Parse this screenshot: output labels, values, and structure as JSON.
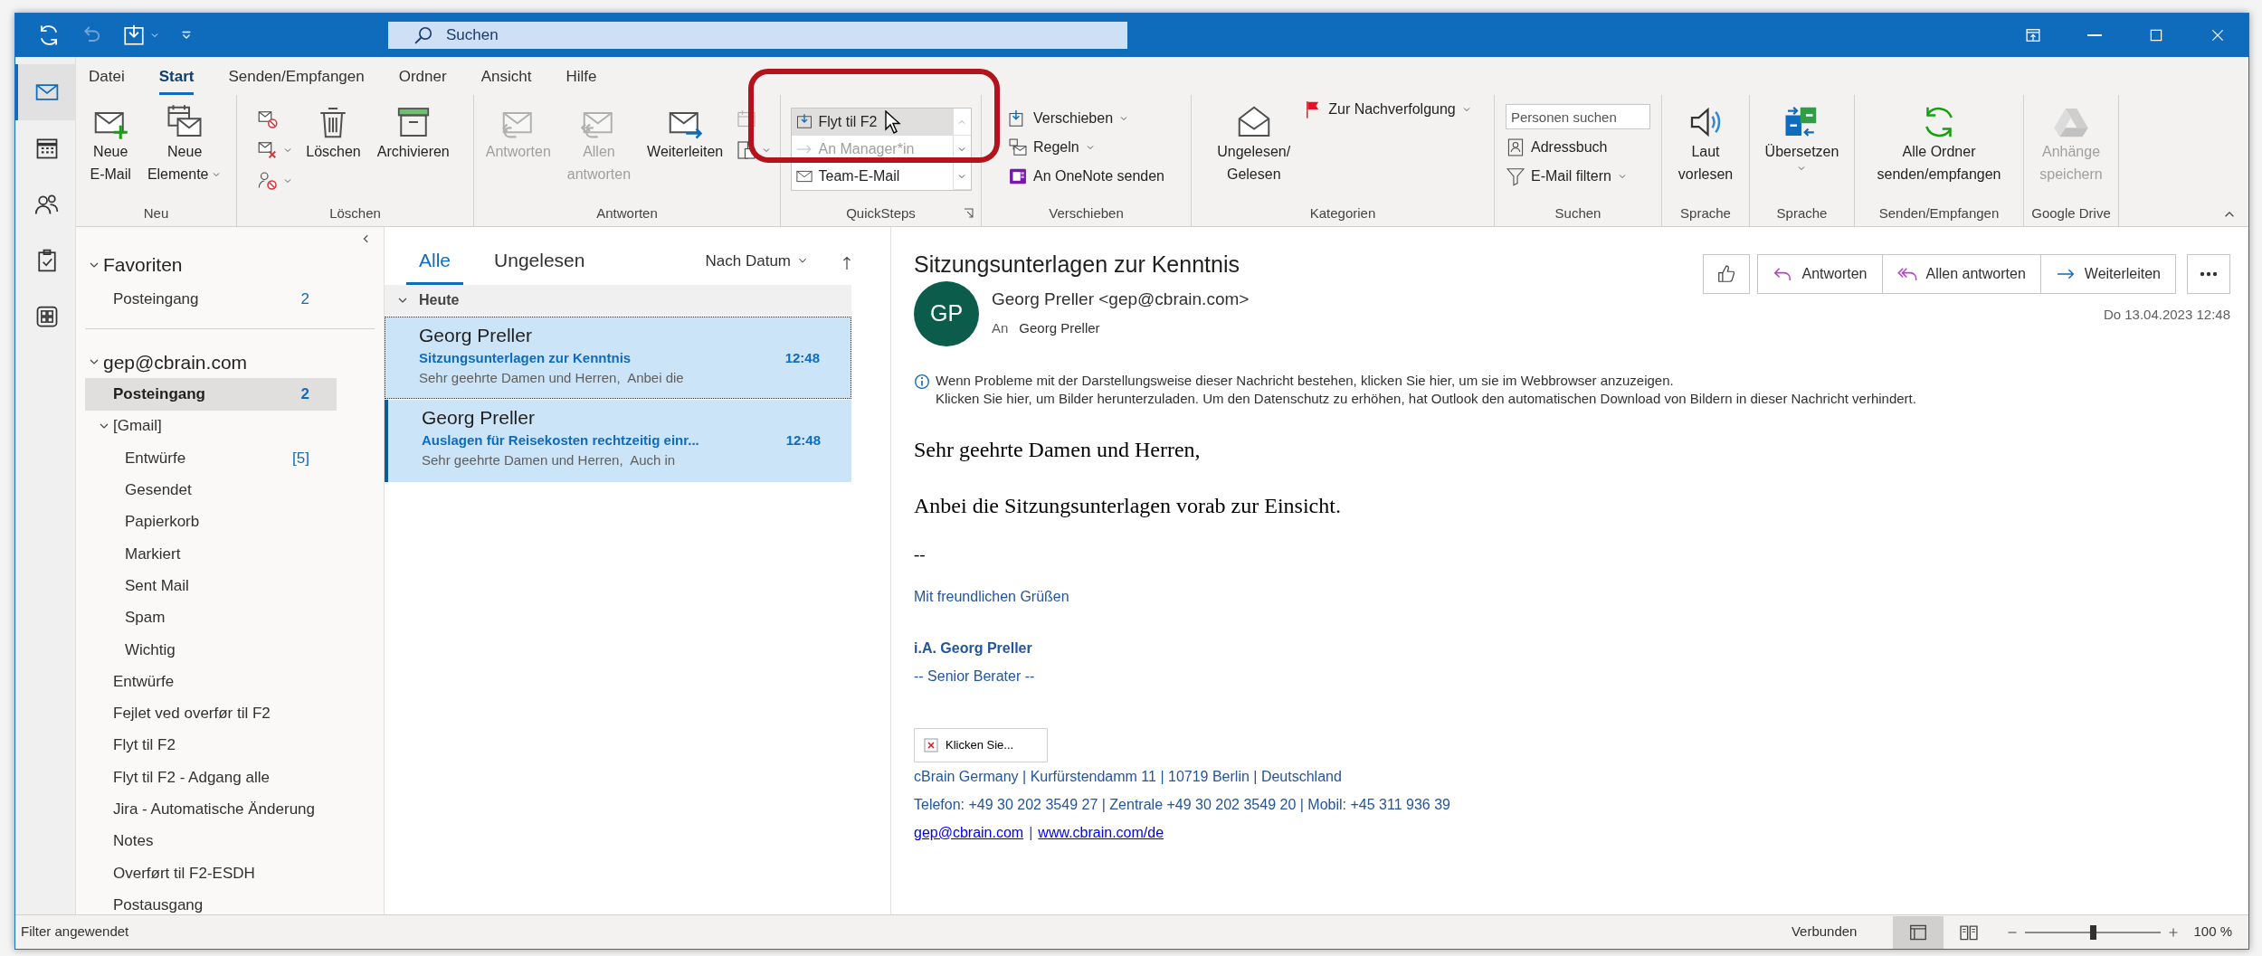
{
  "title_bar": {
    "search_placeholder": "Suchen"
  },
  "ribbon": {
    "tabs": [
      {
        "label": "Datei",
        "selected": false
      },
      {
        "label": "Start",
        "selected": true
      },
      {
        "label": "Senden/Empfangen",
        "selected": false
      },
      {
        "label": "Ordner",
        "selected": false
      },
      {
        "label": "Ansicht",
        "selected": false
      },
      {
        "label": "Hilfe",
        "selected": false
      }
    ],
    "groups": [
      {
        "label": "Neu",
        "items": [
          {
            "kind": "large",
            "label": "Neue\nE-Mail",
            "dropdown": false,
            "disabled": false
          },
          {
            "kind": "large",
            "label": "Neue\nElemente",
            "dropdown": true,
            "disabled": false
          }
        ]
      },
      {
        "label": "Löschen",
        "items": [
          {
            "kind": "stack",
            "items": [
              {
                "kind": "icon",
                "dropdown": false,
                "disabled": false
              },
              {
                "kind": "icon",
                "dropdown": true,
                "disabled": false
              },
              {
                "kind": "icon",
                "dropdown": true,
                "disabled": false
              }
            ]
          },
          {
            "kind": "large",
            "label": "Löschen",
            "dropdown": false,
            "disabled": false
          },
          {
            "kind": "large",
            "label": "Archivieren",
            "dropdown": false,
            "disabled": false
          }
        ]
      },
      {
        "label": "Antworten",
        "items": [
          {
            "kind": "large",
            "label": "Antworten",
            "dropdown": false,
            "disabled": true
          },
          {
            "kind": "large",
            "label": "Allen\nantworten",
            "dropdown": false,
            "disabled": true
          },
          {
            "kind": "large",
            "label": "Weiterleiten",
            "dropdown": false,
            "disabled": false
          },
          {
            "kind": "stack",
            "items": [
              {
                "kind": "icon",
                "dropdown": false,
                "disabled": true
              },
              {
                "kind": "icon",
                "dropdown": true,
                "disabled": false
              }
            ]
          }
        ]
      },
      {
        "label": "QuickSteps",
        "items": [
          {
            "kind": "quicksteps",
            "items": [
              {
                "label": "Flyt til F2",
                "highlighted": true,
                "disabled": false
              },
              {
                "label": "An Manager*in",
                "highlighted": false,
                "disabled": true
              },
              {
                "label": "Team-E-Mail",
                "highlighted": false,
                "disabled": false
              }
            ]
          }
        ]
      },
      {
        "label": "Verschieben",
        "items": [
          {
            "kind": "stack",
            "items": [
              {
                "kind": "small",
                "label": "Verschieben",
                "dropdown": true,
                "disabled": false
              },
              {
                "kind": "small",
                "label": "Regeln",
                "dropdown": true,
                "disabled": false
              },
              {
                "kind": "small",
                "label": "An OneNote senden",
                "dropdown": false,
                "disabled": false
              }
            ]
          }
        ]
      },
      {
        "label": "Kategorien",
        "items": [
          {
            "kind": "large",
            "label": "Ungelesen/\nGelesen",
            "dropdown": false,
            "disabled": false
          },
          {
            "kind": "small",
            "label": "Zur Nachverfolgung",
            "dropdown": true,
            "disabled": false
          }
        ]
      },
      {
        "label": "Suchen",
        "items": [
          {
            "kind": "stack",
            "items": [
              {
                "kind": "search",
                "placeholder": "Personen suchen"
              },
              {
                "kind": "small",
                "label": "Adressbuch",
                "dropdown": false,
                "disabled": false
              },
              {
                "kind": "small",
                "label": "E-Mail filtern",
                "dropdown": true,
                "disabled": false
              }
            ]
          }
        ]
      },
      {
        "label": "Sprache",
        "items": [
          {
            "kind": "large",
            "label": "Laut\nvorlesen",
            "dropdown": false,
            "disabled": false
          }
        ]
      },
      {
        "label": "Sprache",
        "items": [
          {
            "kind": "large",
            "label": "Übersetzen",
            "dropdown": true,
            "disabled": false
          }
        ]
      },
      {
        "label": "Senden/Empfangen",
        "items": [
          {
            "kind": "large",
            "label": "Alle Ordner\nsenden/empfangen",
            "dropdown": false,
            "disabled": false
          }
        ]
      },
      {
        "label": "Google Drive",
        "items": [
          {
            "kind": "large",
            "label": "Anhänge\nspeichern",
            "dropdown": false,
            "disabled": true
          }
        ]
      }
    ]
  },
  "nav_rail": [
    {
      "selected": true
    },
    {
      "selected": false
    },
    {
      "selected": false
    },
    {
      "selected": false
    },
    {
      "selected": false
    }
  ],
  "folders": [
    {
      "label": "Favoriten",
      "expanded": true,
      "children": [
        {
          "label": "Posteingang",
          "count": "2",
          "selected": false
        }
      ]
    },
    {
      "label": "gep@cbrain.com",
      "expanded": true,
      "children": [
        {
          "label": "Posteingang",
          "count": "2",
          "selected": true
        },
        {
          "label": "[Gmail]",
          "expanded": true,
          "selected": false,
          "children": [
            {
              "label": "Entwürfe",
              "count": "[5]",
              "selected": false
            },
            {
              "label": "Gesendet",
              "selected": false
            },
            {
              "label": "Papierkorb",
              "selected": false
            },
            {
              "label": "Markiert",
              "selected": false
            },
            {
              "label": "Sent Mail",
              "selected": false
            },
            {
              "label": "Spam",
              "selected": false
            },
            {
              "label": "Wichtig",
              "selected": false
            }
          ]
        },
        {
          "label": "Entwürfe",
          "selected": false
        },
        {
          "label": "Fejlet ved overfør til F2",
          "selected": false
        },
        {
          "label": "Flyt til F2",
          "selected": false
        },
        {
          "label": "Flyt til F2 - Adgang alle",
          "selected": false
        },
        {
          "label": "Jira - Automatische Änderung",
          "selected": false
        },
        {
          "label": "Notes",
          "selected": false
        },
        {
          "label": "Overført til F2-ESDH",
          "selected": false
        },
        {
          "label": "Postausgang",
          "selected": false
        }
      ]
    }
  ],
  "message_list": {
    "tabs": [
      {
        "label": "Alle",
        "selected": true
      },
      {
        "label": "Ungelesen",
        "selected": false
      }
    ],
    "sort": "Nach Datum",
    "groups": [
      {
        "label": "Heute",
        "expanded": true,
        "messages": [
          {
            "sender": "Georg Preller",
            "subject": "Sitzungsunterlagen zur Kenntnis",
            "time": "12:48",
            "preview": "Sehr geehrte Damen und Herren,  Anbei die",
            "selected": true,
            "focused": true
          },
          {
            "sender": "Georg Preller",
            "subject": "Auslagen für Reisekosten rechtzeitig einr...",
            "time": "12:48",
            "preview": "Sehr geehrte Damen und Herren,  Auch in",
            "selected": true,
            "focused": false
          }
        ]
      }
    ]
  },
  "reading_pane": {
    "subject": "Sitzungsunterlagen zur Kenntnis",
    "avatar": "GP",
    "from": "Georg Preller <gep@cbrain.com>",
    "to_label": "An",
    "to": "Georg Preller",
    "actions": [
      "Antworten",
      "Allen antworten",
      "Weiterleiten"
    ],
    "date": "Do 13.04.2023 12:48",
    "info": [
      "Wenn Probleme mit der Darstellungsweise dieser Nachricht bestehen, klicken Sie hier, um sie im Webbrowser anzuzeigen.",
      "Klicken Sie hier, um Bilder herunterzuladen. Um den Datenschutz zu erhöhen, hat Outlook den automatischen Download von Bildern in dieser Nachricht verhindert."
    ],
    "body": [
      {
        "kind": "serif",
        "text": "Sehr geehrte Damen und Herren,"
      },
      {
        "kind": "serif",
        "text": "Anbei die Sitzungsunterlagen vorab zur Einsicht."
      },
      {
        "kind": "dash",
        "text": "--"
      },
      {
        "kind": "signature",
        "text": "Mit freundlichen Grüßen"
      },
      {
        "kind": "signature_bold",
        "text": "i.A. Georg Preller"
      },
      {
        "kind": "signature",
        "text": "-- Senior Berater --"
      },
      {
        "kind": "image",
        "text": "Klicken Sie..."
      },
      {
        "kind": "signature",
        "text": "cBrain Germany | Kurfürstendamm 11 | 10719 Berlin | Deutschland"
      },
      {
        "kind": "signature",
        "text": "Telefon: +49 30 202 3549 27 | Zentrale +49 30 202 3549 20 | Mobil: +45 311 936 39"
      },
      {
        "kind": "links",
        "links": [
          "gep@cbrain.com",
          "www.cbrain.com/de"
        ],
        "separator": "|"
      }
    ]
  },
  "status_bar": {
    "left": "Filter angewendet",
    "connection": "Verbunden",
    "views": [
      {
        "selected": true
      },
      {
        "selected": false
      }
    ],
    "zoom": {
      "level": 0.5,
      "reading": "100 %"
    }
  }
}
